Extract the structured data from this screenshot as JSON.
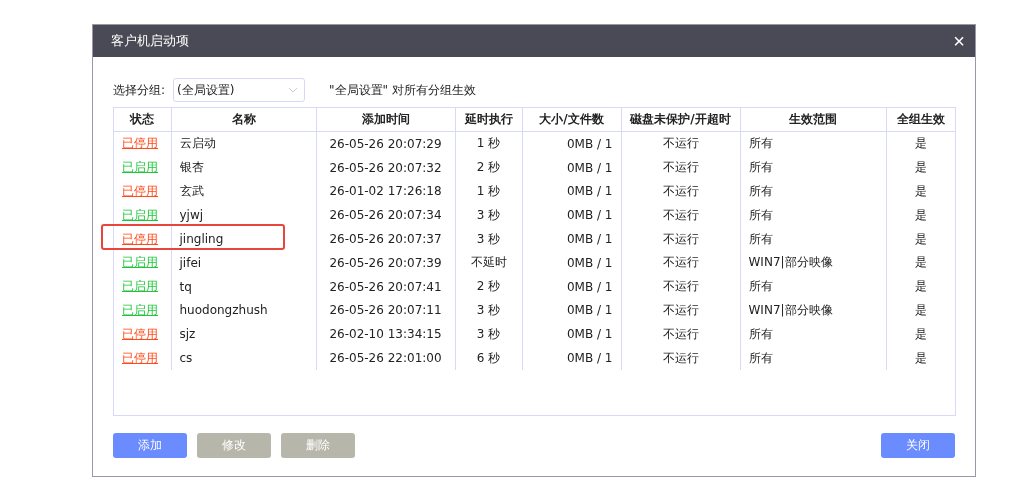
{
  "window": {
    "title": "客户机启动项",
    "close": "×"
  },
  "group": {
    "label": "选择分组:",
    "value": "(全局设置)",
    "note": "\"全局设置\" 对所有分组生效"
  },
  "table": {
    "columns": [
      "状态",
      "名称",
      "添加时间",
      "延时执行",
      "大小/文件数",
      "磁盘未保护/开超时",
      "生效范围",
      "全组生效"
    ],
    "rows": [
      {
        "enabled": false,
        "highlighted": false,
        "cells": [
          "已停用",
          "云启动",
          "26-05-26 20:07:29",
          "1 秒",
          "0MB / 1",
          "不运行",
          "所有",
          "是"
        ]
      },
      {
        "enabled": true,
        "highlighted": false,
        "cells": [
          "已启用",
          "银杏",
          "26-05-26 20:07:32",
          "2 秒",
          "0MB / 1",
          "不运行",
          "所有",
          "是"
        ]
      },
      {
        "enabled": false,
        "highlighted": false,
        "cells": [
          "已停用",
          "玄武",
          "26-01-02 17:26:18",
          "1 秒",
          "0MB / 1",
          "不运行",
          "所有",
          "是"
        ]
      },
      {
        "enabled": true,
        "highlighted": false,
        "cells": [
          "已启用",
          "yjwj",
          "26-05-26 20:07:34",
          "3 秒",
          "0MB / 1",
          "不运行",
          "所有",
          "是"
        ]
      },
      {
        "enabled": false,
        "highlighted": true,
        "cells": [
          "已停用",
          "jingling",
          "26-05-26 20:07:37",
          "3 秒",
          "0MB / 1",
          "不运行",
          "所有",
          "是"
        ]
      },
      {
        "enabled": true,
        "highlighted": false,
        "cells": [
          "已启用",
          "jifei",
          "26-05-26 20:07:39",
          "不延时",
          "0MB / 1",
          "不运行",
          "WIN7|部分映像",
          "是"
        ]
      },
      {
        "enabled": true,
        "highlighted": false,
        "cells": [
          "已启用",
          "tq",
          "26-05-26 20:07:41",
          "2 秒",
          "0MB / 1",
          "不运行",
          "所有",
          "是"
        ]
      },
      {
        "enabled": true,
        "highlighted": false,
        "cells": [
          "已启用",
          "huodongzhush",
          "26-05-26 20:07:11",
          "3 秒",
          "0MB / 1",
          "不运行",
          "WIN7|部分映像",
          "是"
        ]
      },
      {
        "enabled": false,
        "highlighted": false,
        "cells": [
          "已停用",
          "sjz",
          "26-02-10 13:34:15",
          "3 秒",
          "0MB / 1",
          "不运行",
          "所有",
          "是"
        ]
      },
      {
        "enabled": false,
        "highlighted": false,
        "cells": [
          "已停用",
          "cs",
          "26-05-26 22:01:00",
          "6 秒",
          "0MB / 1",
          "不运行",
          "所有",
          "是"
        ]
      }
    ]
  },
  "buttons": [
    {
      "label": "添加",
      "disabled": false
    },
    {
      "label": "修改",
      "disabled": true
    },
    {
      "label": "删除",
      "disabled": true
    }
  ],
  "close_button": {
    "label": "关闭",
    "disabled": false
  }
}
